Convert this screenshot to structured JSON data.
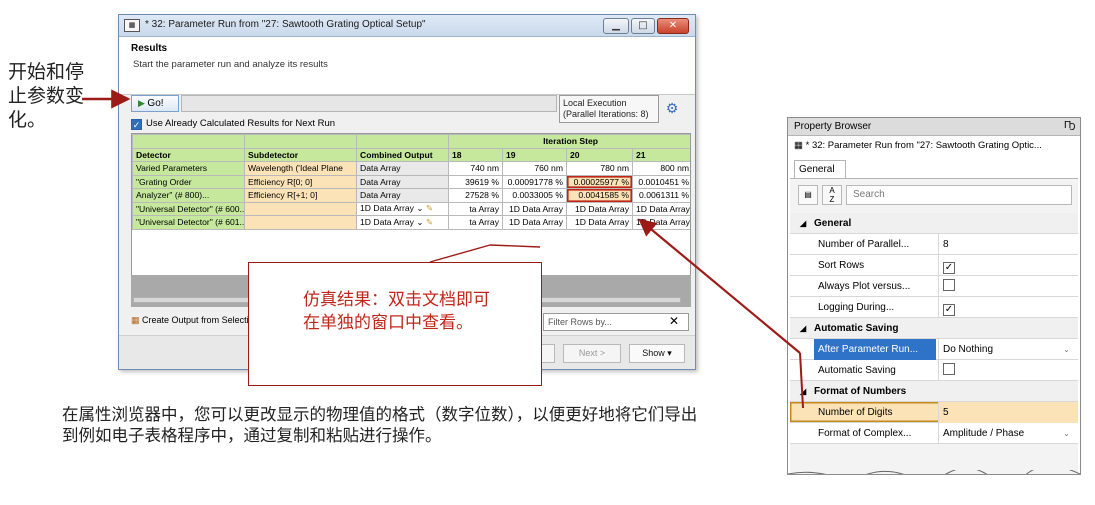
{
  "annotations": {
    "left_note": "开始和停止参数变化。",
    "callout": "仿真结果：双击文档即可在单独的窗口中查看。",
    "bottom_note": "在属性浏览器中，您可以更改显示的物理值的格式（数字位数），以便更好地将它们导出到例如电子表格程序中，通过复制和粘贴进行操作。"
  },
  "window": {
    "title": "* 32: Parameter Run from \"27: Sawtooth Grating Optical Setup\"",
    "header_title": "Results",
    "header_subtitle": "Start the parameter run and analyze its results",
    "go_label": "Go!",
    "exec_line1": "Local Execution",
    "exec_line2": "(Parallel Iterations: 8)",
    "reuse_label": "Use Already Calculated Results for Next Run",
    "create_output_label": "Create Output from Selecti",
    "filter_placeholder": "Filter Rows by...",
    "back_label": "ck",
    "next_label": "Next >",
    "show_label": "Show ▾"
  },
  "table": {
    "group_header": "Iteration Step",
    "col_headers": [
      "Detector",
      "Subdetector",
      "Combined Output"
    ],
    "iterations": [
      "18",
      "19",
      "20",
      "21"
    ],
    "rows": [
      {
        "detector": "Varied Parameters",
        "sub": "Wavelength ('Ideal Plane",
        "combined": "Data Array",
        "vals": [
          "740 nm",
          "760 nm",
          "780 nm",
          "800 nm"
        ]
      },
      {
        "detector": "\"Grating Order",
        "sub": "Efficiency R[0; 0]",
        "combined": "Data Array",
        "vals": [
          "39619 %",
          "0.00091778 %",
          "0.00025977 %",
          "0.0010451 %"
        ]
      },
      {
        "detector": "Analyzer\" (# 800)...",
        "sub": "Efficiency R[+1; 0]",
        "combined": "Data Array",
        "vals": [
          "27528 %",
          "0.0033005 %",
          "0.0041585 %",
          "0.0061311 %"
        ]
      },
      {
        "detector": "\"Universal Detector\" (# 600...",
        "sub": "",
        "combined": "1D Data Array",
        "vals": [
          "ta Array",
          "1D Data Array",
          "1D Data Array",
          "1D Data Array"
        ]
      },
      {
        "detector": "\"Universal Detector\" (# 601...",
        "sub": "",
        "combined": "1D Data Array",
        "vals": [
          "ta Array",
          "1D Data Array",
          "1D Data Array",
          "1D Data Array"
        ]
      }
    ]
  },
  "property_browser": {
    "title": "Property Browser",
    "pin": "Ҧ",
    "run_name": "* 32: Parameter Run from \"27: Sawtooth Grating Optic...",
    "tab": "General",
    "search_placeholder": "Search",
    "sections": [
      {
        "name": "General",
        "rows": [
          {
            "label": "Number of Parallel...",
            "value": "8"
          },
          {
            "label": "Sort Rows",
            "checked": true
          },
          {
            "label": "Always Plot versus...",
            "checked": false
          },
          {
            "label": "Logging During...",
            "checked": true
          }
        ]
      },
      {
        "name": "Automatic Saving",
        "rows": [
          {
            "label": "After Parameter Run...",
            "value": "Do Nothing"
          },
          {
            "label": "Automatic Saving",
            "checked": false
          }
        ]
      },
      {
        "name": "Format of Numbers",
        "rows": [
          {
            "label": "Number of Digits",
            "value": "5"
          },
          {
            "label": "Format of Complex...",
            "value": "Amplitude / Phase"
          }
        ]
      }
    ]
  },
  "colors": {
    "accent_red": "#c0271b",
    "green_cell": "#c5e89c",
    "yellow_cell": "#fbe3b7",
    "select_blue": "#2f73c9"
  }
}
